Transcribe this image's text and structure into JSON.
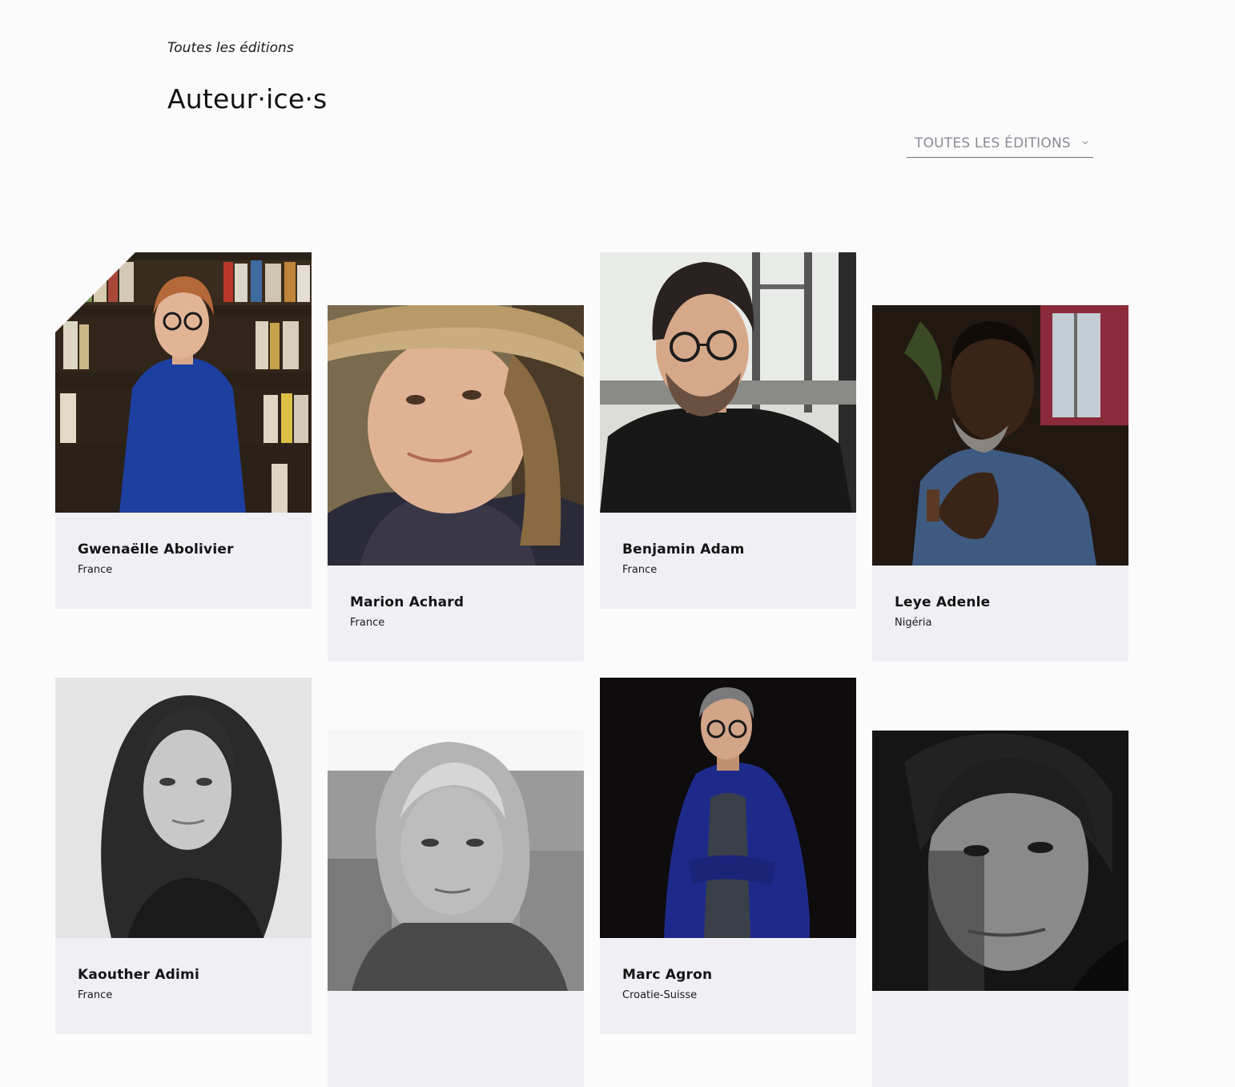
{
  "breadcrumb": "Toutes les éditions",
  "title": "Auteur·ice·s",
  "filter": {
    "selected": "TOUTES LES ÉDITIONS",
    "icon": "chevron-down-icon"
  },
  "authors": [
    {
      "name": "Gwenaëlle Abolivier",
      "country": "France"
    },
    {
      "name": "Marion Achard",
      "country": "France"
    },
    {
      "name": "Benjamin Adam",
      "country": "France"
    },
    {
      "name": "Leye Adenle",
      "country": "Nigéria"
    },
    {
      "name": "Kaouther Adimi",
      "country": "France"
    },
    {
      "name": "",
      "country": ""
    },
    {
      "name": "Marc Agron",
      "country": "Croatie-Suisse"
    },
    {
      "name": "",
      "country": ""
    }
  ],
  "colors": {
    "background": "#fbfbfc",
    "card": "#f0eff4",
    "text": "#141414",
    "muted": "#8b8b95"
  }
}
